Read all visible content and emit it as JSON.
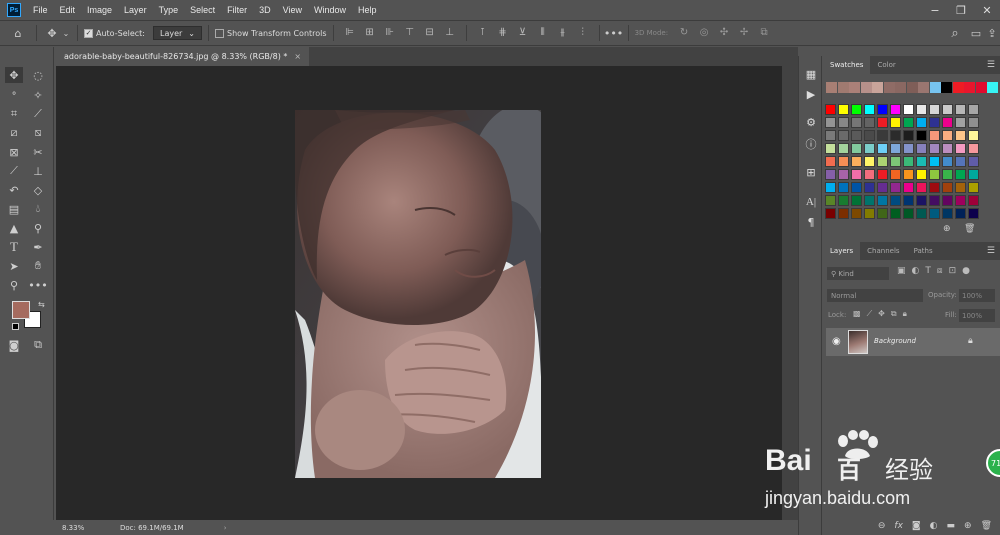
{
  "menubar": {
    "logo": "Ps",
    "items": [
      "File",
      "Edit",
      "Image",
      "Layer",
      "Type",
      "Select",
      "Filter",
      "3D",
      "View",
      "Window",
      "Help"
    ]
  },
  "options": {
    "auto_select_label": "Auto-Select:",
    "auto_select_value": "Layer",
    "show_transform_label": "Show Transform Controls",
    "mode_3d_label": "3D Mode:"
  },
  "document": {
    "tab_title": "adorable-baby-beautiful-826734.jpg @ 8.33% (RGB/8) *"
  },
  "status": {
    "zoom": "8.33%",
    "doc_info": "Doc: 69.1M/69.1M"
  },
  "swatches": {
    "tabs": [
      "Swatches",
      "Color"
    ],
    "recent": [
      "#a87f74",
      "#a07a70",
      "#ab8078",
      "#b6908a",
      "#c9a49a",
      "#8f6c66",
      "#8a6862",
      "#7f5e58",
      "#9a7670",
      "#77c4f0",
      "#000000",
      "#ee1c24",
      "#e8162d",
      "#e00b2e",
      "#37f5f5"
    ],
    "grid": [
      [
        "#ff0000",
        "#ffff00",
        "#00ff00",
        "#00ffff",
        "#0000ff",
        "#ff00ff",
        "#ffffff",
        "#e6e6e6",
        "#d6d6d6",
        "#c9c9c9",
        "#b7b7b7",
        "#a6a6a6"
      ],
      [
        "#949494",
        "#878787",
        "#767676",
        "#636363",
        "#ef1c24",
        "#fff200",
        "#00a651",
        "#00aeef",
        "#2e3192",
        "#ec008c",
        "#a1a1a1",
        "#8f8f8f"
      ],
      [
        "#7a7a7a",
        "#6a6a6a",
        "#5a5a5a",
        "#4a4a4a",
        "#3a3a3a",
        "#2b2b2b",
        "#1d1d1d",
        "#000000",
        "#f7977a",
        "#f9ad81",
        "#fdc68a",
        "#fff79a"
      ],
      [
        "#c4df9b",
        "#a3d39c",
        "#82ca9d",
        "#7accc8",
        "#6dcff6",
        "#7da7d9",
        "#8393ca",
        "#8781bd",
        "#a187be",
        "#bc8dbf",
        "#f49ac2",
        "#f6989d"
      ],
      [
        "#f26c4f",
        "#f68e55",
        "#fbaf5c",
        "#fff467",
        "#acd372",
        "#7cc576",
        "#3bb878",
        "#1abbb4",
        "#00bff3",
        "#438ccb",
        "#5574b9",
        "#605ca8"
      ],
      [
        "#855fa8",
        "#a763a8",
        "#f06ea9",
        "#f26d7d",
        "#ed1c24",
        "#f26522",
        "#f7941d",
        "#fff200",
        "#8dc63f",
        "#39b54a",
        "#00a651",
        "#00a99d"
      ],
      [
        "#00aeef",
        "#0072bc",
        "#0054a6",
        "#2e3192",
        "#662d91",
        "#92278f",
        "#ec008c",
        "#ed145b",
        "#9e0b0f",
        "#a0410d",
        "#a3620a",
        "#aba000"
      ],
      [
        "#598527",
        "#197b30",
        "#007236",
        "#00746b",
        "#0076a3",
        "#004b80",
        "#003471",
        "#1b1464",
        "#440e62",
        "#630460",
        "#9e005d",
        "#9e0039"
      ],
      [
        "#790000",
        "#7b2e00",
        "#7d4900",
        "#827b00",
        "#406618",
        "#005e20",
        "#005826",
        "#005952",
        "#005b7f",
        "#003663",
        "#002157",
        "#0d004c"
      ]
    ]
  },
  "layers": {
    "tabs": [
      "Layers",
      "Channels",
      "Paths"
    ],
    "filter_kind": "Kind",
    "blend_mode": "Normal",
    "opacity_label": "Opacity:",
    "opacity_value": "100%",
    "lock_label": "Lock:",
    "fill_label": "Fill:",
    "fill_value": "100%",
    "items": [
      {
        "name": "Background",
        "visible": true,
        "locked": true
      }
    ]
  },
  "colors": {
    "foreground": "#a56b5f",
    "background": "#ffffff",
    "canvas_bg": "#282828",
    "ui_bg": "#535353"
  },
  "watermark": {
    "brand": "Bai",
    "brand_tail": "百",
    "cn": "经验",
    "url": "jingyan.baidu.com",
    "badge": "71"
  }
}
